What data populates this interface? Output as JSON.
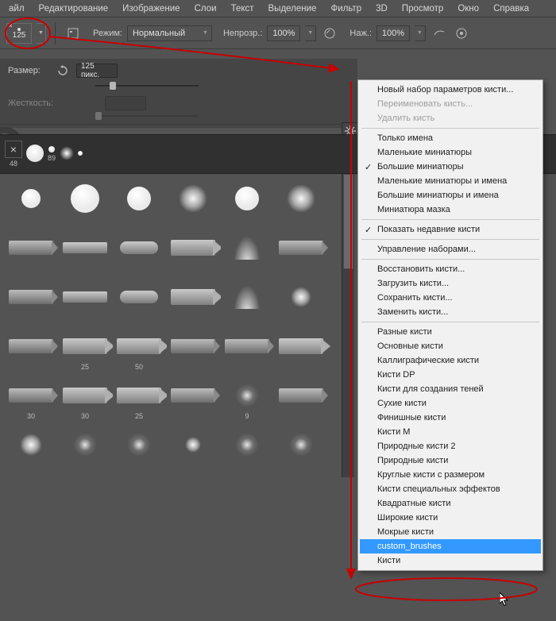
{
  "menu": [
    "айл",
    "Редактирование",
    "Изображение",
    "Слои",
    "Текст",
    "Выделение",
    "Фильтр",
    "3D",
    "Просмотр",
    "Окно",
    "Справка"
  ],
  "options": {
    "brush_size": "125",
    "mode_label": "Режим:",
    "mode_value": "Нормальный",
    "opacity_label": "Непрозр.:",
    "opacity_value": "100%",
    "flow_label": "Наж.:",
    "flow_value": "100%"
  },
  "panel": {
    "size_label": "Размер:",
    "size_value": "125 пикс.",
    "hardness_label": "Жесткость:"
  },
  "preset_strip": [
    {
      "label": "48"
    },
    {
      "label": ""
    },
    {
      "label": "89"
    },
    {
      "label": ""
    },
    {
      "label": ""
    }
  ],
  "grid": [
    [
      {
        "t": "hard",
        "s": 24
      },
      {
        "t": "hard",
        "s": 36
      },
      {
        "t": "hard",
        "s": 30
      },
      {
        "t": "soft",
        "s": 36
      },
      {
        "t": "hard",
        "s": 30
      },
      {
        "t": "soft",
        "s": 36
      }
    ],
    [
      {
        "t": "tip"
      },
      {
        "t": "flat"
      },
      {
        "t": "round"
      },
      {
        "t": "pencil"
      },
      {
        "t": "fan"
      },
      {
        "t": "tip"
      }
    ],
    [
      {
        "t": "tip"
      },
      {
        "t": "flat"
      },
      {
        "t": "round"
      },
      {
        "t": "pencil"
      },
      {
        "t": "fan"
      },
      {
        "t": "soft",
        "s": 26
      }
    ],
    [
      {
        "t": "tip",
        "cap": ""
      },
      {
        "t": "pencil",
        "cap": "25"
      },
      {
        "t": "pencil",
        "cap": "50"
      },
      {
        "t": "tip",
        "cap": ""
      },
      {
        "t": "tip",
        "cap": ""
      },
      {
        "t": "pencil",
        "cap": ""
      }
    ],
    [
      {
        "t": "tip",
        "cap": "30"
      },
      {
        "t": "pencil",
        "cap": "30"
      },
      {
        "t": "pencil",
        "cap": "25"
      },
      {
        "t": "tip",
        "cap": ""
      },
      {
        "t": "spray",
        "cap": "9"
      },
      {
        "t": "tip",
        "cap": ""
      }
    ],
    [
      {
        "t": "soft",
        "s": 28
      },
      {
        "t": "spray"
      },
      {
        "t": "spray"
      },
      {
        "t": "soft",
        "s": 20
      },
      {
        "t": "spray"
      },
      {
        "t": "spray"
      }
    ]
  ],
  "ctx": [
    {
      "label": "Новый набор параметров кисти..."
    },
    {
      "label": "Переименовать кисть...",
      "disabled": true
    },
    {
      "label": "Удалить кисть",
      "disabled": true
    },
    {
      "sep": true
    },
    {
      "label": "Только имена"
    },
    {
      "label": "Маленькие миниатюры"
    },
    {
      "label": "Большие миниатюры",
      "checked": true
    },
    {
      "label": "Маленькие миниатюры и имена"
    },
    {
      "label": "Большие миниатюры и имена"
    },
    {
      "label": "Миниатюра мазка"
    },
    {
      "sep": true
    },
    {
      "label": "Показать недавние кисти",
      "checked": true
    },
    {
      "sep": true
    },
    {
      "label": "Управление наборами..."
    },
    {
      "sep": true
    },
    {
      "label": "Восстановить кисти..."
    },
    {
      "label": "Загрузить кисти..."
    },
    {
      "label": "Сохранить кисти..."
    },
    {
      "label": "Заменить кисти..."
    },
    {
      "sep": true
    },
    {
      "label": "Разные кисти"
    },
    {
      "label": "Основные кисти"
    },
    {
      "label": "Каллиграфические кисти"
    },
    {
      "label": "Кисти DP"
    },
    {
      "label": "Кисти для создания теней"
    },
    {
      "label": "Сухие кисти"
    },
    {
      "label": "Финишные кисти"
    },
    {
      "label": "Кисти M"
    },
    {
      "label": "Природные кисти 2"
    },
    {
      "label": "Природные кисти"
    },
    {
      "label": "Круглые кисти с размером"
    },
    {
      "label": "Кисти специальных эффектов"
    },
    {
      "label": "Квадратные кисти"
    },
    {
      "label": "Широкие кисти"
    },
    {
      "label": "Мокрые кисти"
    },
    {
      "label": "custom_brushes",
      "selected": true
    },
    {
      "label": "Кисти"
    }
  ]
}
